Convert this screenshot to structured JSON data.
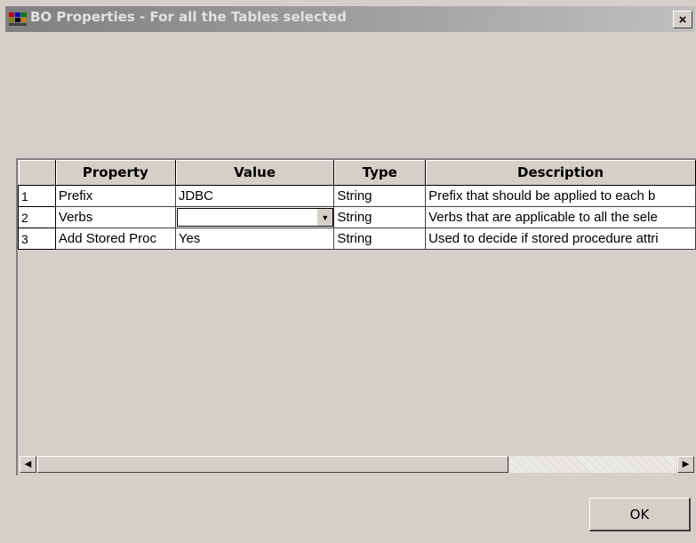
{
  "window": {
    "title": "BO Properties - For all the Tables selected",
    "close_label": "×",
    "icon": "app-icon"
  },
  "grid": {
    "columns": [
      "",
      "Property",
      "Value",
      "Type",
      "Description"
    ],
    "rows": [
      {
        "num": "1",
        "property": "Prefix",
        "value": "JDBC",
        "type": "String",
        "description": "Prefix that should be applied to each b"
      },
      {
        "num": "2",
        "property": "Verbs",
        "value": "",
        "type": "String",
        "description": "Verbs that are applicable to all the sele"
      },
      {
        "num": "3",
        "property": "Add Stored Proc",
        "value": "Yes",
        "type": "String",
        "description": "Used to decide if stored procedure attri"
      }
    ],
    "scroll_left_label": "◀",
    "scroll_right_label": "▶",
    "dropdown_arrow_label": "▼"
  },
  "buttons": {
    "ok_label": "OK"
  }
}
